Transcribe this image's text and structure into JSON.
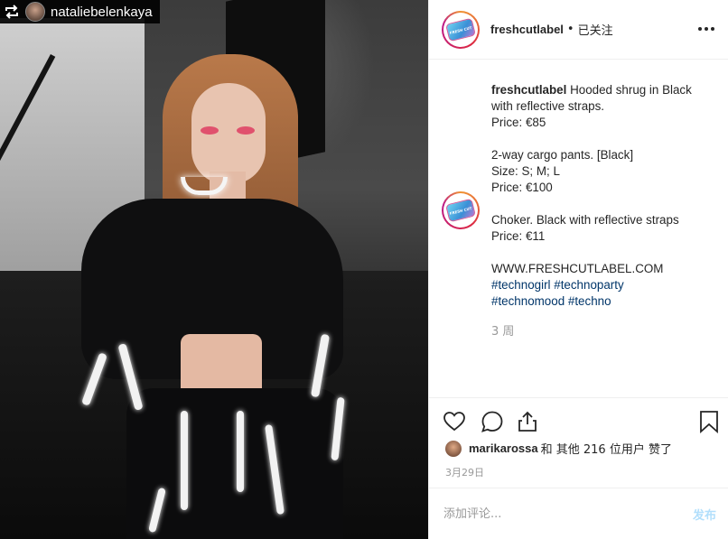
{
  "photo": {
    "repost_username": "nataliebelenkaya",
    "repost_icon": "repost-icon"
  },
  "header": {
    "username": "freshcutlabel",
    "separator": "•",
    "follow_status": "已关注",
    "more_icon": "more-horizontal-icon",
    "logo_text": "FRESH CUT"
  },
  "caption": {
    "username": "freshcutlabel",
    "lines": [
      "Hooded shrug in Black",
      "with reflective straps.",
      "Price: €85",
      "",
      "2-way cargo pants. [Black]",
      "Size: S; M; L",
      "Price: €100",
      "",
      "Choker. Black with reflective straps",
      "Price: €11",
      "",
      "WWW.FRESHCUTLABEL.COM"
    ],
    "hashtags": [
      [
        "#technogirl",
        "#technoparty"
      ],
      [
        "#technomood",
        "#techno"
      ]
    ],
    "time_ago": "3 周"
  },
  "actions": {
    "like_icon": "heart-icon",
    "comment_icon": "comment-icon",
    "share_icon": "share-icon",
    "save_icon": "bookmark-icon"
  },
  "likes": {
    "liker": "marikarossa",
    "rest": "和 其他 216 位用户 赞了"
  },
  "date": "3月29日",
  "comment": {
    "placeholder": "添加评论...",
    "post_label": "发布"
  }
}
